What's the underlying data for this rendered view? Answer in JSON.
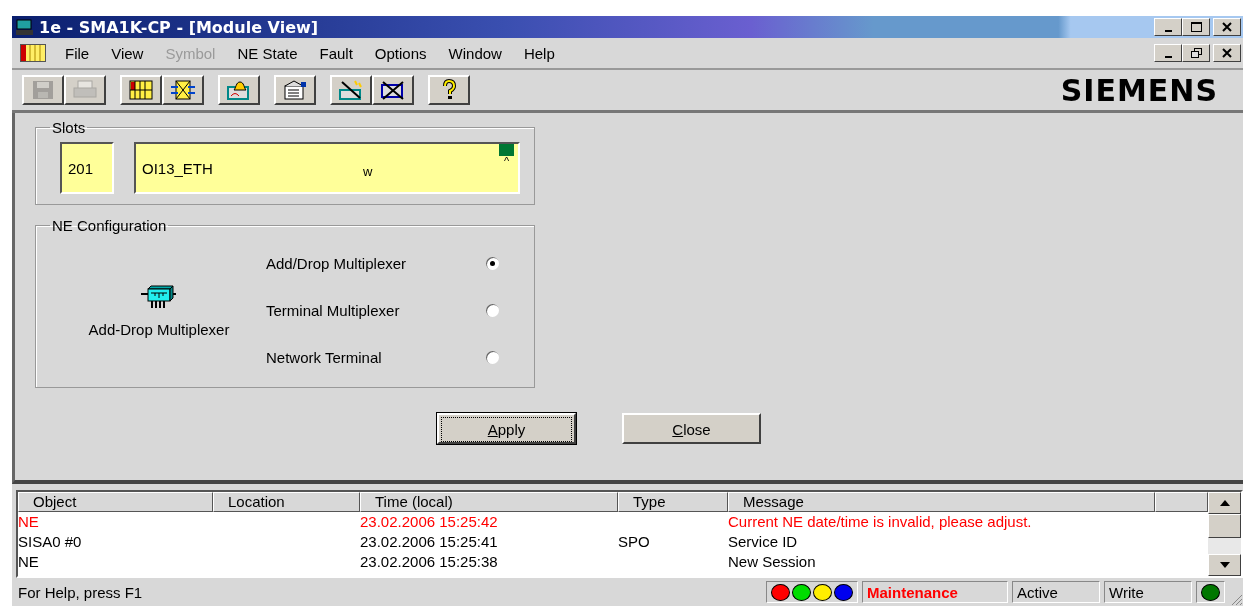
{
  "window": {
    "title": "1e - SMA1K-CP - [Module View]"
  },
  "menu": [
    {
      "label": "File",
      "disabled": false
    },
    {
      "label": "View",
      "disabled": false
    },
    {
      "label": "Symbol",
      "disabled": true
    },
    {
      "label": "NE State",
      "disabled": false
    },
    {
      "label": "Fault",
      "disabled": false
    },
    {
      "label": "Options",
      "disabled": false
    },
    {
      "label": "Window",
      "disabled": false
    },
    {
      "label": "Help",
      "disabled": false
    }
  ],
  "toolbar": [
    {
      "kind": "save",
      "disabled": true
    },
    {
      "kind": "print",
      "disabled": true
    },
    {
      "kind": "grid",
      "disabled": false
    },
    {
      "kind": "cross",
      "disabled": false
    },
    {
      "kind": "alarm",
      "disabled": false
    },
    {
      "kind": "properties",
      "disabled": false
    },
    {
      "kind": "connect",
      "disabled": false
    },
    {
      "kind": "disconnect",
      "disabled": false
    },
    {
      "kind": "help",
      "disabled": false
    }
  ],
  "brand": "SIEMENS",
  "slots": {
    "title": "Slots",
    "number": "201",
    "module": "OI13_ETH",
    "flag": "w",
    "marker": "^"
  },
  "ne_configuration": {
    "title": "NE Configuration",
    "device_label": "Add-Drop Multiplexer",
    "options": [
      {
        "label": "Add/Drop Multiplexer",
        "selected": true
      },
      {
        "label": "Terminal Multiplexer",
        "selected": false
      },
      {
        "label": "Network Terminal",
        "selected": false
      }
    ]
  },
  "buttons": [
    {
      "label": "Apply",
      "default": true
    },
    {
      "label": "Close",
      "default": false
    }
  ],
  "log": {
    "columns": [
      "Object",
      "Location",
      "Time (local)",
      "Type",
      "Message"
    ],
    "rows": [
      {
        "kind": "error",
        "cells": [
          "NE",
          "",
          "23.02.2006 15:25:42",
          "",
          "Current NE date/time is invalid, please adjust."
        ]
      },
      {
        "kind": "normal",
        "cells": [
          "SISA0 #0",
          "",
          "23.02.2006 15:25:41",
          "SPO",
          "Service ID"
        ]
      },
      {
        "kind": "normal",
        "cells": [
          "NE",
          "",
          "23.02.2006 15:25:38",
          "",
          "New Session"
        ]
      }
    ]
  },
  "status_bar": {
    "help": "For Help, press F1",
    "lamps": [
      {
        "color": "#ff0000"
      },
      {
        "color": "#00dd00"
      },
      {
        "color": "#ffee00"
      },
      {
        "color": "#0000ee"
      }
    ],
    "mode": "Maintenance",
    "state": "Active",
    "access": "Write",
    "indicator": {
      "color": "#007700"
    }
  }
}
